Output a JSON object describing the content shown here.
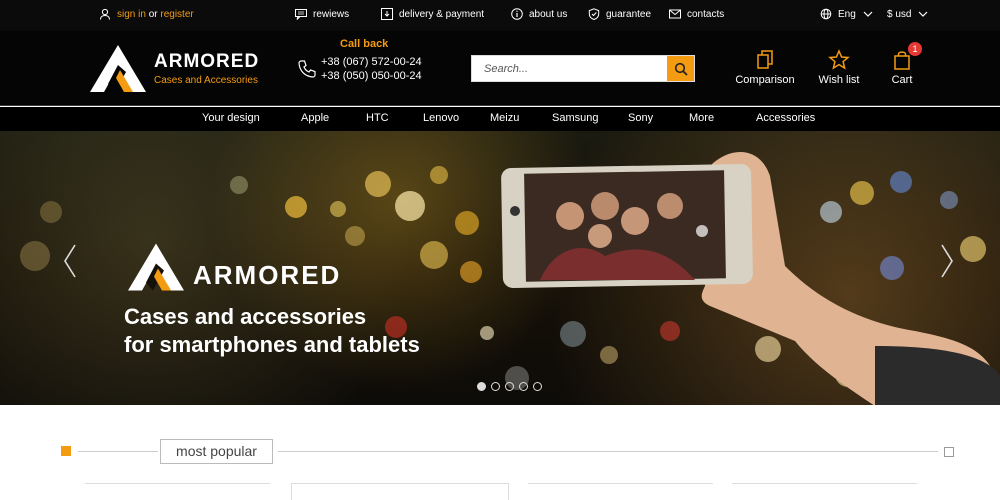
{
  "topbar": {
    "sign_in": "sign in",
    "or": "or",
    "register": "register",
    "reviews": "rewiews",
    "delivery": "delivery & payment",
    "about": "about us",
    "guarantee": "guarantee",
    "contacts": "contacts",
    "language": "Eng",
    "currency": "$ usd"
  },
  "header": {
    "brand": "ARMORED",
    "tagline": "Cases and Accessories",
    "callback_title": "Call back",
    "phones": [
      "+38 (067) 572-00-24",
      "+38 (050) 050-00-24"
    ],
    "search_placeholder": "Search...",
    "comparison": "Comparison",
    "wishlist": "Wish list",
    "cart": "Cart",
    "cart_count": "1"
  },
  "nav": [
    "Your design",
    "Apple",
    "HTC",
    "Lenovo",
    "Meizu",
    "Samsung",
    "Sony",
    "More",
    "Accessories"
  ],
  "hero": {
    "brand": "ARMORED",
    "line1": "Cases and accessories",
    "line2": "for smartphones and tablets",
    "slide_count": 5,
    "active_slide": 1
  },
  "section": {
    "title": "most popular"
  },
  "colors": {
    "accent": "#f39c12",
    "badge": "#e53935",
    "dark": "#050505"
  }
}
